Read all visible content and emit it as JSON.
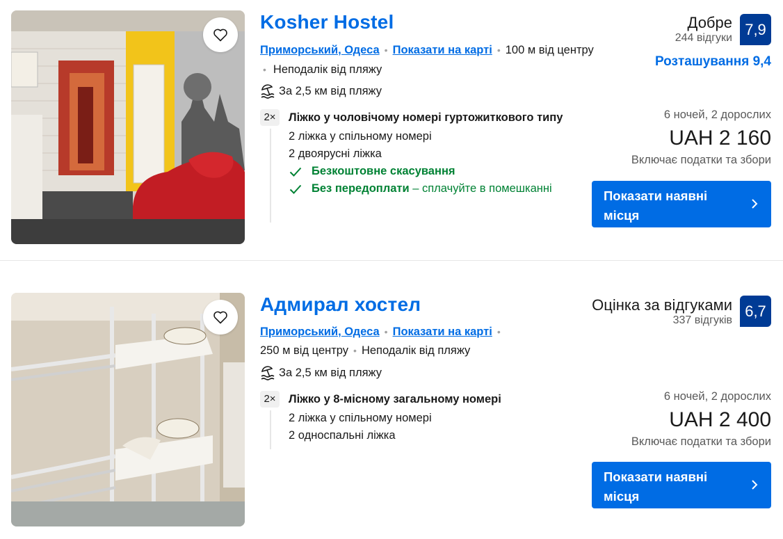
{
  "listings": [
    {
      "name": "Kosher Hostel",
      "district": "Приморський, Одеса",
      "map_link": "Показати на карті",
      "distance_center": "100 м від центру",
      "near_beach": "Неподалік від пляжу",
      "beach_distance": "За 2,5 км від пляжу",
      "room_count": "2×",
      "room_name": "Ліжко у чоловічому номері гуртожиткового типу",
      "bed_info_1": "2 ліжка у спільному номері",
      "bed_info_2": "2 двоярусні ліжка",
      "perk_1": "Безкоштовне скасування",
      "perk_2": "Без передоплати",
      "perk_2_suffix": " – сплачуйте в помешканні",
      "rating_label": "Добре",
      "reviews": "244 відгуки",
      "score": "7,9",
      "location_score": "Розташування 9,4",
      "stay": "6 ночей, 2 дорослих",
      "price": "UAH 2 160",
      "taxes": "Включає податки та збори",
      "cta": "Показати наявні місця"
    },
    {
      "name": "Адмирал хостел",
      "district": "Приморський, Одеса",
      "map_link": "Показати на карті",
      "distance_center": "250 м від центру",
      "near_beach": "Неподалік від пляжу",
      "beach_distance": "За 2,5 км від пляжу",
      "room_count": "2×",
      "room_name": "Ліжко у 8-місному загальному номері",
      "bed_info_1": "2 ліжка у спільному номері",
      "bed_info_2": "2 односпальні ліжка",
      "rating_label": "Оцінка за відгуками",
      "reviews": "337 відгуків",
      "score": "6,7",
      "stay": "6 ночей, 2 дорослих",
      "price": "UAH 2 400",
      "taxes": "Включає податки та збори",
      "cta": "Показати наявні місця"
    }
  ],
  "colors": {
    "link": "#006ce4",
    "score_badge": "#003b95",
    "perk_green": "#008234",
    "cta": "#006ce4"
  },
  "icons": [
    "heart-icon",
    "beach-umbrella-icon",
    "check-icon",
    "chevron-right-icon"
  ]
}
